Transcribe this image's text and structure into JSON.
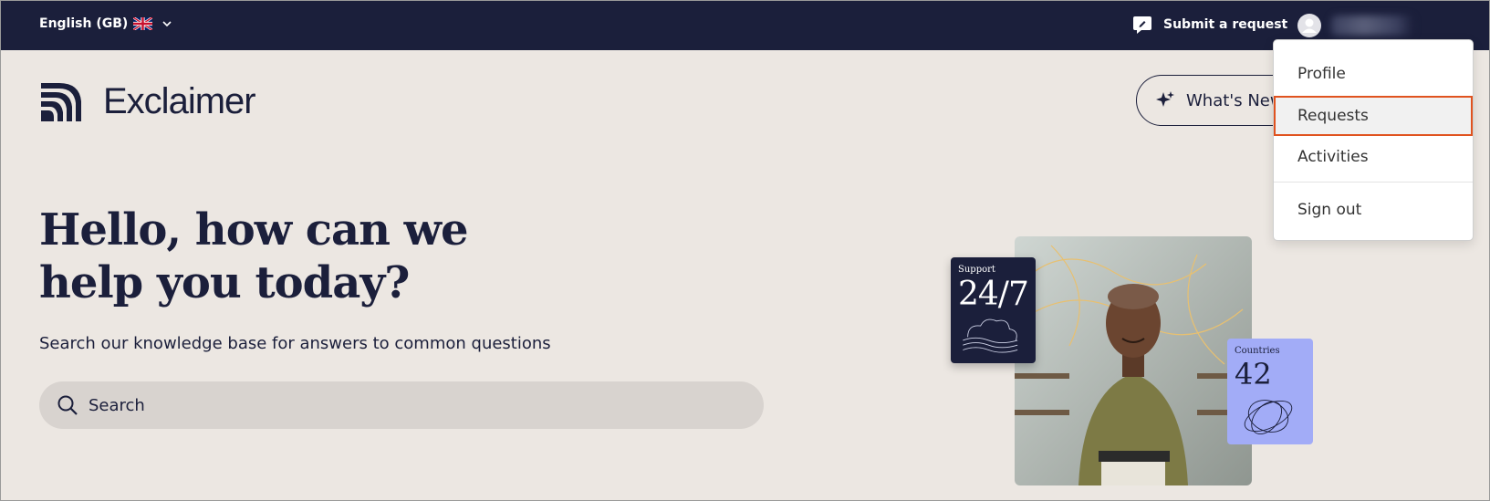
{
  "header": {
    "language": "English (GB)",
    "submit_request": "Submit a request"
  },
  "brand": {
    "name": "Exclaimer"
  },
  "whats_new": {
    "label": "What's New"
  },
  "hero": {
    "title_line1": "Hello, how can we",
    "title_line2": "help you today?",
    "subtitle": "Search our knowledge base for answers to common questions"
  },
  "search": {
    "placeholder": "Search"
  },
  "cards": {
    "support": {
      "label": "Support",
      "value": "24/7"
    },
    "countries": {
      "label": "Countries",
      "value": "42"
    }
  },
  "user_menu": {
    "items": [
      "Profile",
      "Requests",
      "Activities",
      "Sign out"
    ],
    "selected": "Requests"
  },
  "colors": {
    "navy": "#1b1f3b",
    "background": "#ece7e2",
    "accent_outline": "#e0531f",
    "countries_card": "#a2acf7"
  }
}
